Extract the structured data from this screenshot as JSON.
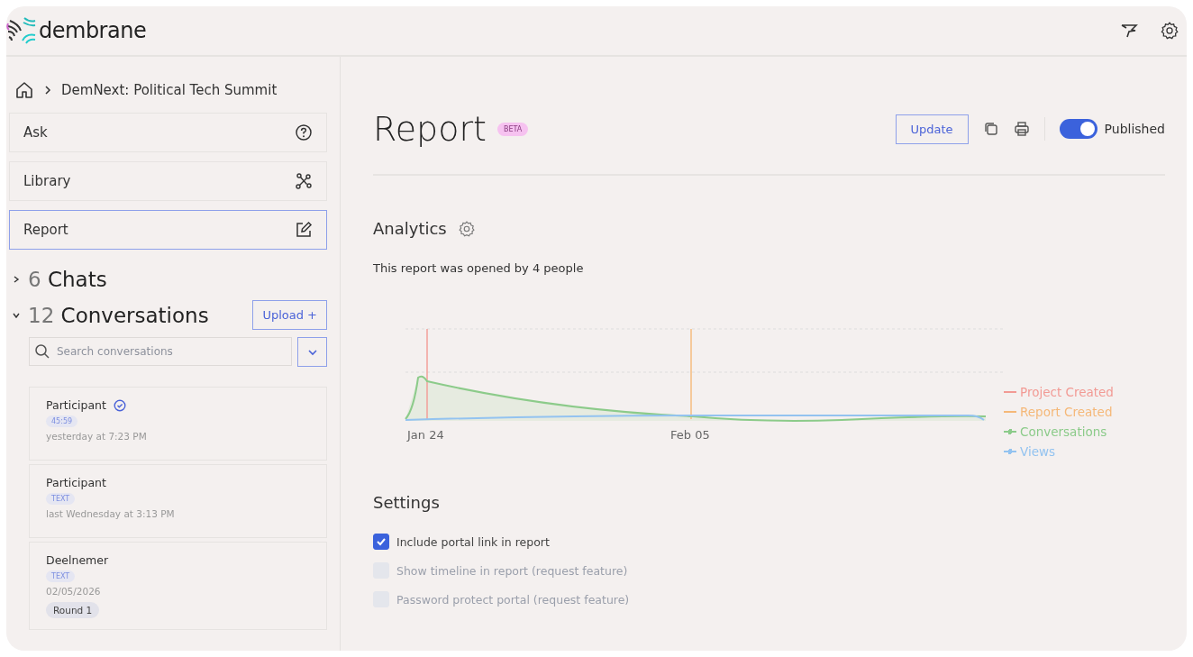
{
  "header": {
    "logo": "dembrane"
  },
  "breadcrumb": {
    "project": "DemNext: Political Tech Summit"
  },
  "nav": [
    {
      "label": "Ask",
      "selected": false
    },
    {
      "label": "Library",
      "selected": false
    },
    {
      "label": "Report",
      "selected": true
    }
  ],
  "chats": {
    "count": "6",
    "label": "Chats",
    "expanded": false
  },
  "conversations": {
    "count": "12",
    "label": "Conversations",
    "expanded": true,
    "upload_button": "Upload +",
    "search": {
      "placeholder": "Search conversations"
    },
    "items": [
      {
        "name": "Participant",
        "verified": true,
        "tag": "45:59",
        "date": "yesterday at 7:23 PM"
      },
      {
        "name": "Participant",
        "verified": false,
        "tag": "TEXT",
        "date": "last Wednesday at 3:13 PM"
      },
      {
        "name": "Deelnemer",
        "verified": false,
        "tag": "TEXT",
        "date": "02/05/2026",
        "chip": "Round 1"
      }
    ]
  },
  "report": {
    "title": "Report",
    "badge": "BETA",
    "update_button": "Update",
    "published": {
      "label": "Published",
      "on": true
    }
  },
  "analytics": {
    "title": "Analytics",
    "summary": "This report was opened by 4 people",
    "chart": {
      "x_labels": [
        "Jan 24",
        "Feb 05"
      ],
      "legend": [
        {
          "label": "Project Created",
          "color": "#f29a94",
          "marker": false
        },
        {
          "label": "Report Created",
          "color": "#f5b878",
          "marker": false
        },
        {
          "label": "Conversations",
          "color": "#8ccb8a",
          "marker": true
        },
        {
          "label": "Views",
          "color": "#93c3f0",
          "marker": true
        }
      ]
    }
  },
  "settings": {
    "title": "Settings",
    "options": [
      {
        "label": "Include portal link in report",
        "checked": true,
        "disabled": false
      },
      {
        "label": "Show timeline in report (request feature)",
        "checked": false,
        "disabled": true
      },
      {
        "label": "Password protect portal (request feature)",
        "checked": false,
        "disabled": true
      }
    ]
  }
}
